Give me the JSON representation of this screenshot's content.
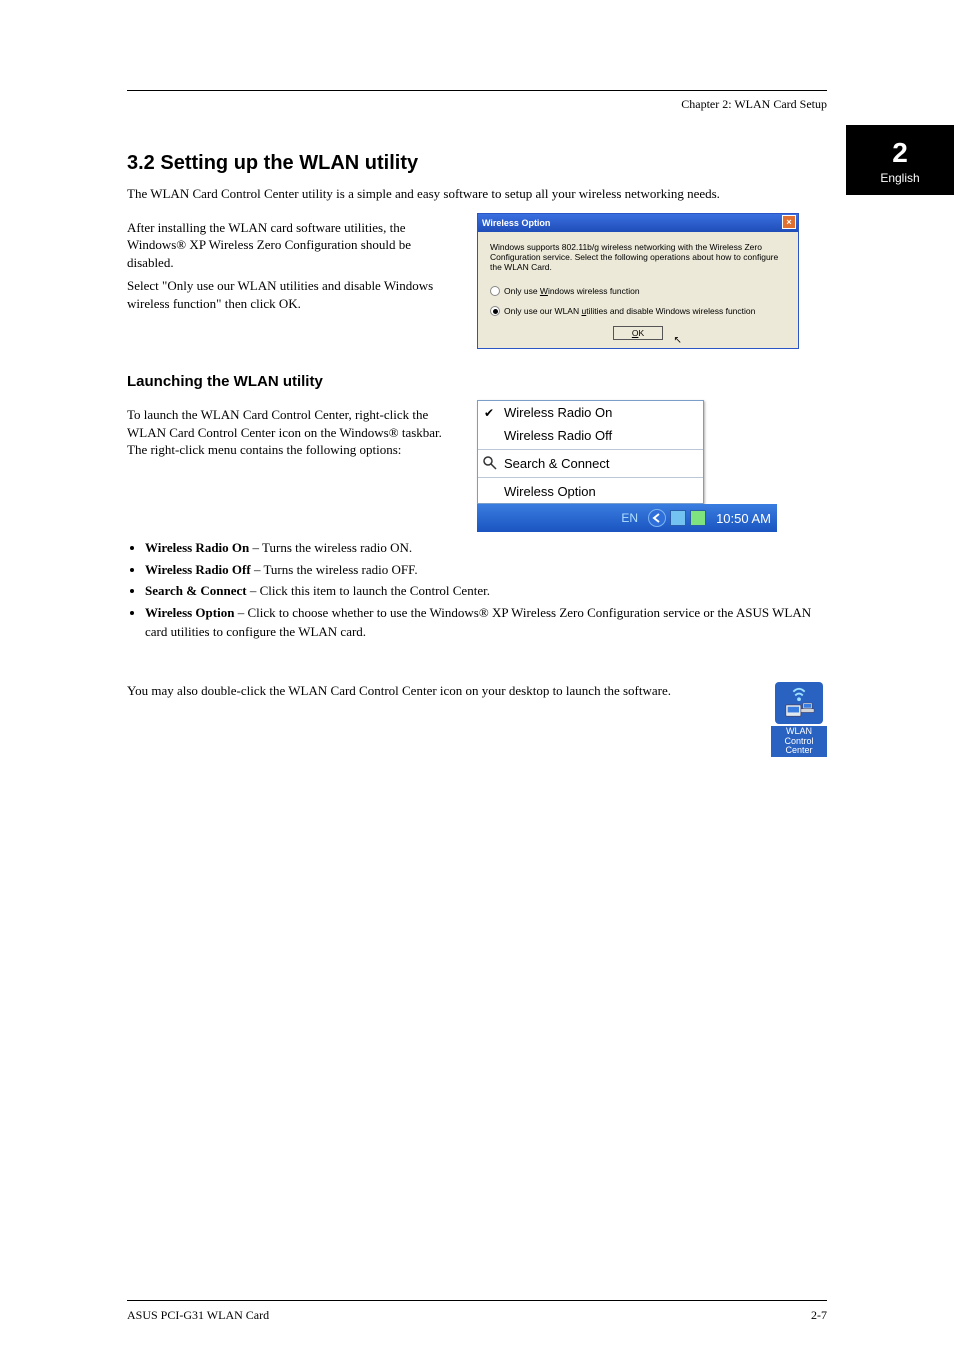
{
  "chapter_header": "Chapter 2: WLAN Card Setup",
  "side_tab": {
    "num": "2",
    "label": "English"
  },
  "section_title": "3.2 Setting up the WLAN utility",
  "p_intro": "The WLAN Card Control Center utility is a simple and easy software to setup all your wireless networking needs.",
  "dialog_block": {
    "p1": "After installing the WLAN card software utilities, the Windows® XP Wireless Zero Configuration should be disabled.",
    "p2": "Select \"Only use our WLAN utilities and disable Windows wireless function\" then click OK."
  },
  "dialog": {
    "title": "Wireless Option",
    "desc": "Windows supports 802.11b/g wireless networking with the Wireless Zero Configuration service. Select the following operations about how to configure the WLAN Card.",
    "opt1_pre": "Only use ",
    "opt1_acc": "W",
    "opt1_post": "indows wireless function",
    "opt2_pre": "Only use our WLAN ",
    "opt2_acc": "u",
    "opt2_post": "tilities and disable Windows wireless function",
    "ok": "OK",
    "ok_acc": "O"
  },
  "tray_block": {
    "heading": "Launching the WLAN utility",
    "p1": "To launch the WLAN Card Control Center, right-click the WLAN Card Control Center icon on the Windows® taskbar. The right-click menu contains the following options:"
  },
  "tray_menu": {
    "items": [
      "Wireless Radio On",
      "Wireless Radio Off",
      "Search & Connect",
      "Wireless Option"
    ]
  },
  "taskbar": {
    "lang": "EN",
    "clock": "10:50 AM"
  },
  "options": [
    {
      "label": "Wireless Radio On",
      "desc": "Turns the wireless radio ON."
    },
    {
      "label": "Wireless Radio Off",
      "desc": "Turns the wireless radio OFF."
    },
    {
      "label": "Search & Connect",
      "desc": "Click this item to launch the Control Center."
    },
    {
      "label": "Wireless Option",
      "desc": "Click to choose whether to use the Windows® XP Wireless Zero Configuration service or the ASUS WLAN card utilities to configure the WLAN card."
    }
  ],
  "desktop_icon_block": {
    "caption": "WLAN\nControl Center",
    "p": "You may also double-click the WLAN Card Control Center icon on your desktop to launch the software."
  },
  "footer": {
    "left": "ASUS PCI-G31 WLAN Card",
    "right": "2-7"
  }
}
